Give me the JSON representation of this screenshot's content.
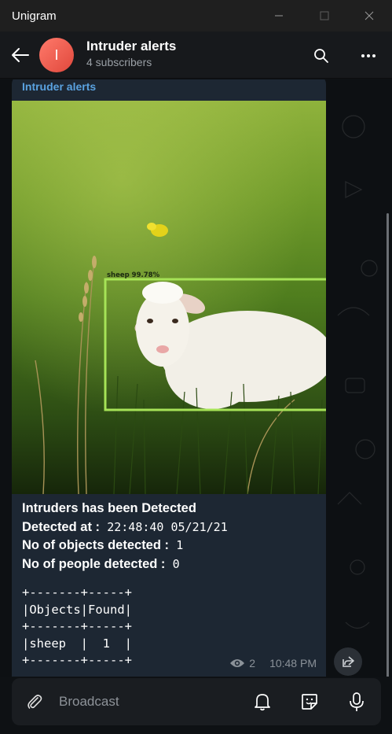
{
  "window": {
    "title": "Unigram"
  },
  "channel": {
    "avatar_letter": "I",
    "name": "Intruder alerts",
    "subtitle": "4 subscribers"
  },
  "message": {
    "sender": "Intruder alerts",
    "detection_label": "sheep 99.78%",
    "lines": [
      {
        "label": "Intruders has been Detected",
        "value": ""
      },
      {
        "label": "Detected at :",
        "value": "22:48:40 05/21/21"
      },
      {
        "label": "No of objects detected :",
        "value": "1"
      },
      {
        "label": "No of people detected :",
        "value": "0"
      }
    ],
    "table_lines": [
      "+-------+-----+",
      "|Objects|Found|",
      "+-------+-----+",
      "|sheep  |  1  |",
      "+-------+-----+"
    ],
    "views": "2",
    "time": "10:48 PM"
  },
  "composer": {
    "placeholder": "Broadcast"
  },
  "icons": {
    "back": "arrow-left-icon",
    "search": "search-icon",
    "more": "more-dots-icon",
    "attach": "paperclip-icon",
    "notifications": "bell-icon",
    "stickers": "sticker-icon",
    "voice": "microphone-icon",
    "views": "eye-icon",
    "share": "share-icon"
  },
  "colors": {
    "accent": "#5aa2e0",
    "bubble": "#1d2733",
    "detection_box": "#a6e357",
    "avatar": "#e0483c"
  }
}
